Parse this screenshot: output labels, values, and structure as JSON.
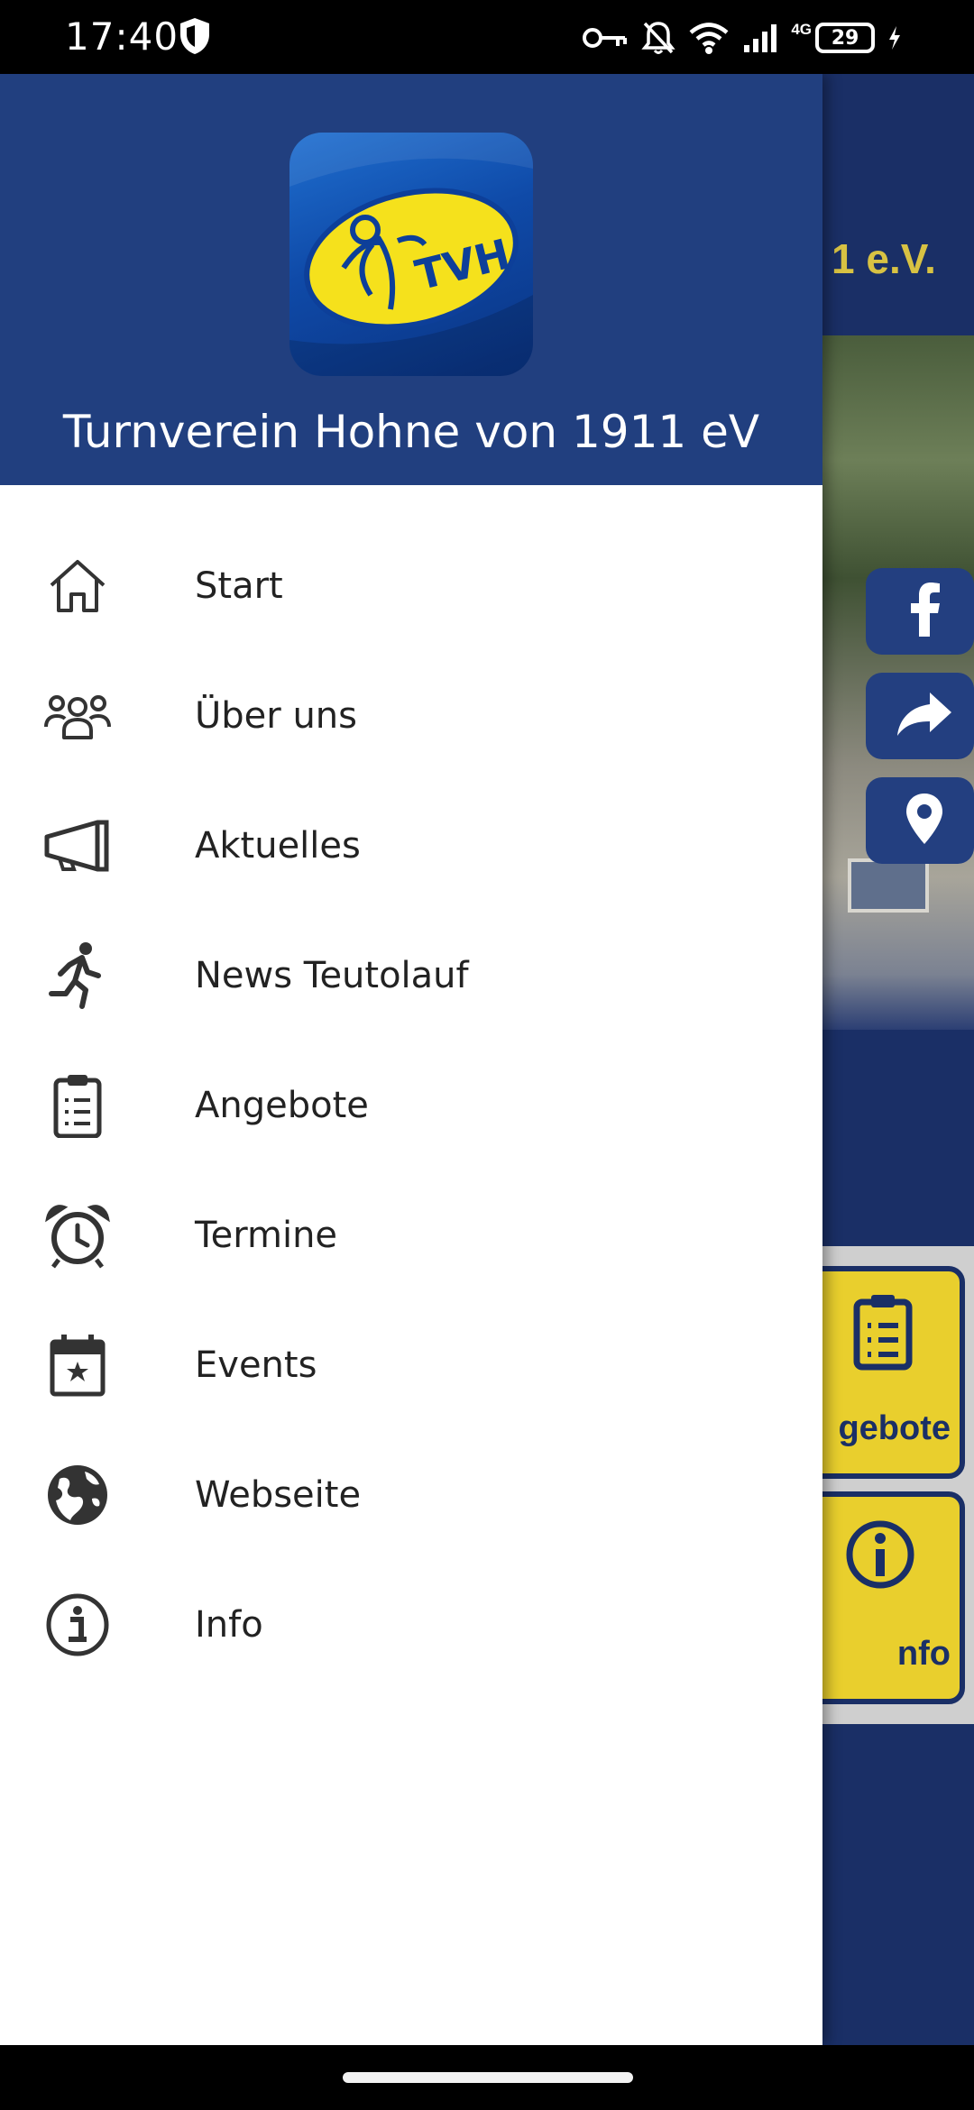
{
  "status_bar": {
    "time": "17:40",
    "network": "4G",
    "battery": "29",
    "icons": [
      "shield-icon",
      "vpn-key-icon",
      "notifications-off-icon",
      "wifi-icon",
      "signal-icon",
      "battery-icon",
      "charging-icon"
    ]
  },
  "drawer": {
    "title": "Turnverein Hohne von 1911 eV",
    "logo_text": "TVH",
    "items": [
      {
        "label": "Start",
        "icon": "home-icon"
      },
      {
        "label": "Über uns",
        "icon": "group-icon"
      },
      {
        "label": "Aktuelles",
        "icon": "megaphone-icon"
      },
      {
        "label": "News Teutolauf",
        "icon": "running-icon"
      },
      {
        "label": "Angebote",
        "icon": "clipboard-list-icon"
      },
      {
        "label": "Termine",
        "icon": "alarm-clock-icon"
      },
      {
        "label": "Events",
        "icon": "calendar-star-icon"
      },
      {
        "label": "Webseite",
        "icon": "globe-icon"
      },
      {
        "label": "Info",
        "icon": "info-icon"
      }
    ]
  },
  "background": {
    "header_text": "1 e.V.",
    "social": [
      "facebook-icon",
      "share-icon",
      "location-icon"
    ],
    "tiles": [
      {
        "label": "gebote",
        "icon": "clipboard-list-icon"
      },
      {
        "label": "nfo",
        "icon": "info-icon"
      }
    ]
  },
  "colors": {
    "header_blue": "#213f7f",
    "background_navy": "#1a2f66",
    "tile_yellow": "#e9cf2d",
    "logo_yellow": "#f5e11c"
  }
}
